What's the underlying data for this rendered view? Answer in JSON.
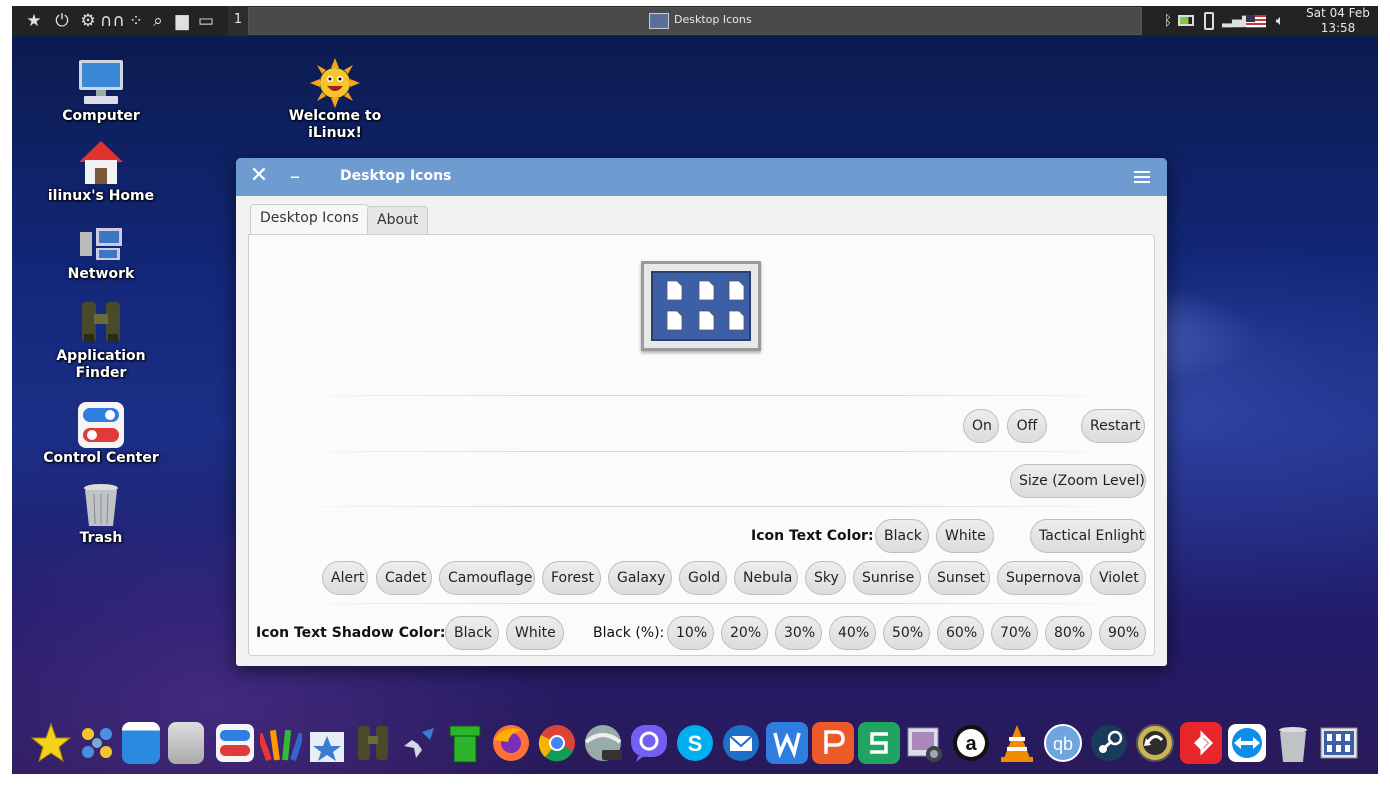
{
  "top_panel": {
    "workspace": "1",
    "task_title": "Desktop Icons",
    "clock_date": "Sat 04 Feb",
    "clock_time": "13:58"
  },
  "desktop_icons": [
    {
      "label_line1": "Computer",
      "label_line2": ""
    },
    {
      "label_line1": "ilinux's Home",
      "label_line2": ""
    },
    {
      "label_line1": "Network",
      "label_line2": ""
    },
    {
      "label_line1": "Application",
      "label_line2": "Finder"
    },
    {
      "label_line1": "Control Center",
      "label_line2": ""
    },
    {
      "label_line1": "Trash",
      "label_line2": ""
    },
    {
      "label_line1": "Welcome to",
      "label_line2": "iLinux!"
    }
  ],
  "window": {
    "title": "Desktop Icons",
    "tabs": [
      "Desktop Icons",
      "About"
    ],
    "buttons": {
      "on": "On",
      "off": "Off",
      "restart": "Restart",
      "size": "Size (Zoom Level)"
    },
    "icon_text_color_label": "Icon Text Color:",
    "icon_text_colors": [
      "Black",
      "White"
    ],
    "tactical": "Tactical Enlight",
    "themes": [
      "Alert",
      "Cadet",
      "Camouflage",
      "Forest",
      "Galaxy",
      "Gold",
      "Nebula",
      "Sky",
      "Sunrise",
      "Sunset",
      "Supernova",
      "Violet"
    ],
    "shadow_label": "Icon Text Shadow Color:",
    "shadow_colors": [
      "Black",
      "White"
    ],
    "black_percent_label": "Black (%):",
    "percents": [
      "10%",
      "20%",
      "30%",
      "40%",
      "50%",
      "60%",
      "70%",
      "80%",
      "90%"
    ]
  },
  "colors": {
    "titlebar": "#6f9cd0",
    "panel": "#232323"
  }
}
